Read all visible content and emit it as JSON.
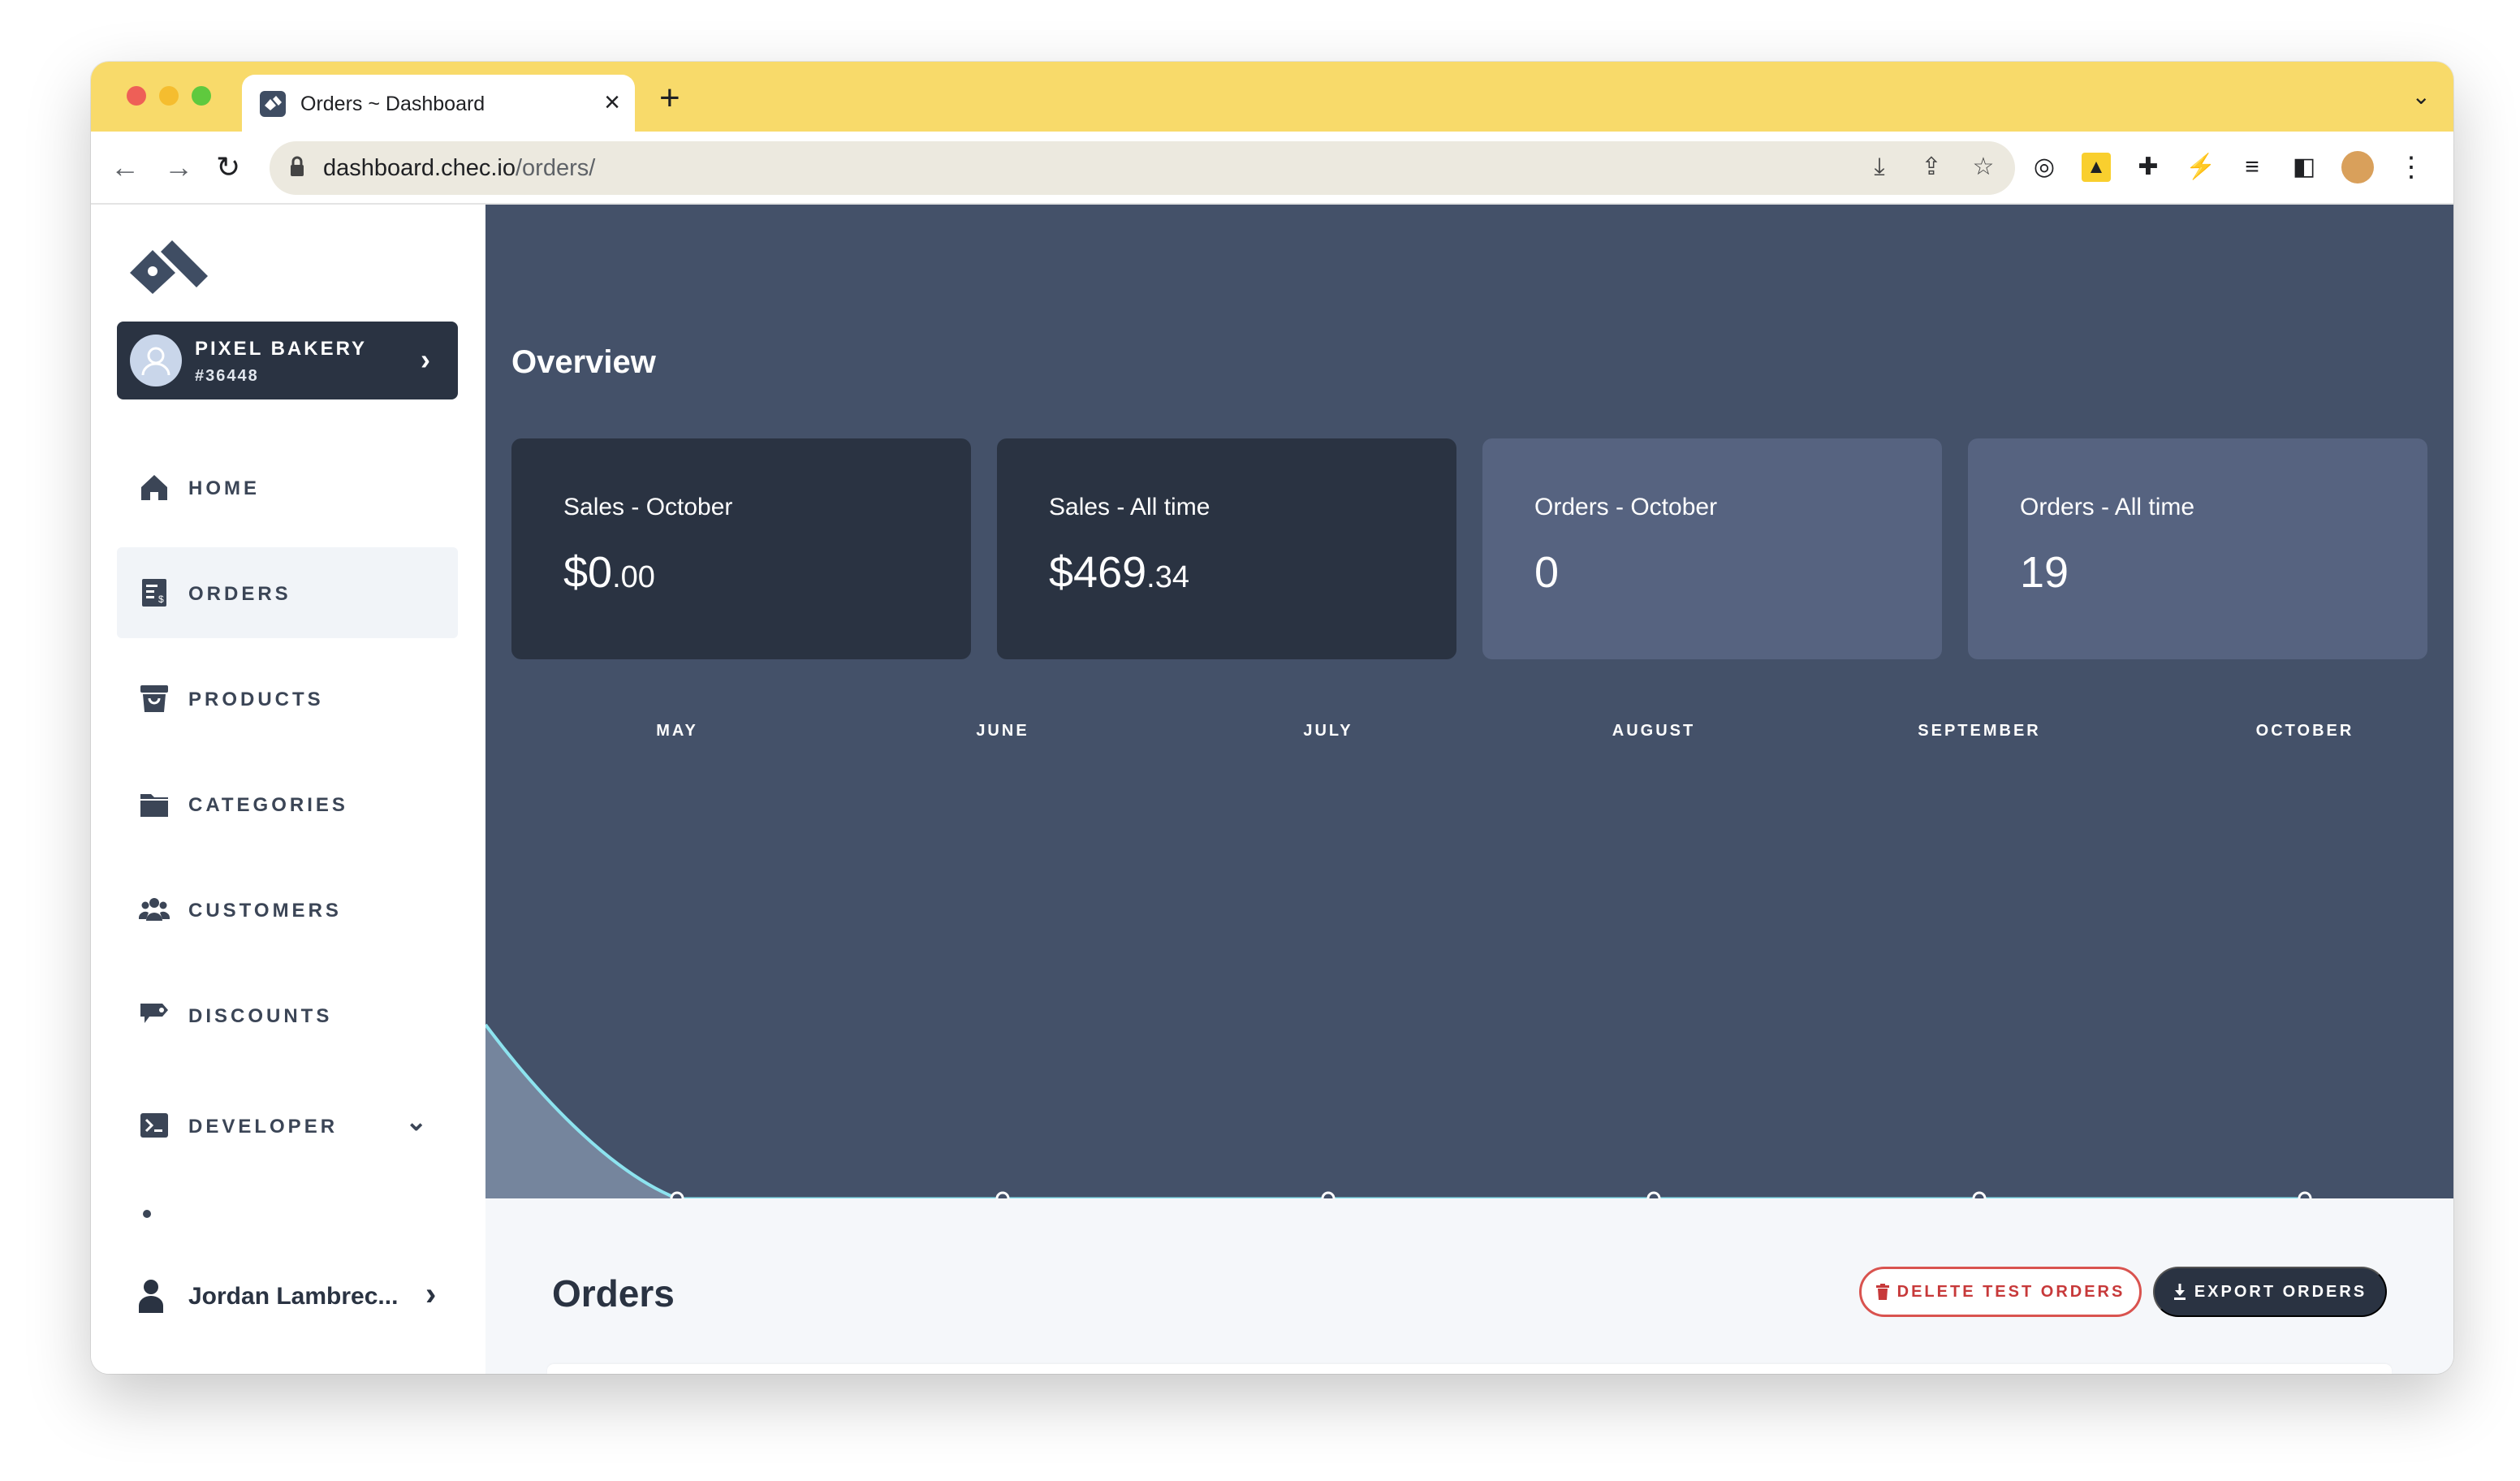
{
  "browser": {
    "tab_title": "Orders ~ Dashboard",
    "tab_close": "×",
    "new_tab": "+",
    "url_host": "dashboard.chec.io",
    "url_path": "/orders/"
  },
  "sidebar": {
    "store": {
      "name": "PIXEL BAKERY",
      "id": "#36448"
    },
    "items": [
      {
        "label": "HOME",
        "icon": "home-icon"
      },
      {
        "label": "ORDERS",
        "icon": "orders-icon",
        "active": true
      },
      {
        "label": "PRODUCTS",
        "icon": "products-icon"
      },
      {
        "label": "CATEGORIES",
        "icon": "folder-icon"
      },
      {
        "label": "CUSTOMERS",
        "icon": "users-icon"
      },
      {
        "label": "DISCOUNTS",
        "icon": "tag-icon"
      },
      {
        "label": "DEVELOPER",
        "icon": "terminal-icon"
      }
    ],
    "user_name": "Jordan Lambrec..."
  },
  "overview": {
    "title": "Overview",
    "cards": [
      {
        "label": "Sales - October",
        "value_main": "$0",
        "value_cents": ".00"
      },
      {
        "label": "Sales - All time",
        "value_main": "$469",
        "value_cents": ".34"
      },
      {
        "label": "Orders - October",
        "value_main": "0",
        "value_cents": ""
      },
      {
        "label": "Orders - All time",
        "value_main": "19",
        "value_cents": ""
      }
    ]
  },
  "chart_data": {
    "type": "area",
    "categories": [
      "MAY",
      "JUNE",
      "JULY",
      "AUGUST",
      "SEPTEMBER",
      "OCTOBER"
    ],
    "series": [
      {
        "values": [
          0,
          0,
          0,
          0,
          0,
          0
        ],
        "color": "#8de3ef"
      }
    ]
  },
  "orders": {
    "title": "Orders",
    "delete_label": "DELETE TEST ORDERS",
    "export_label": "EXPORT ORDERS"
  },
  "colors": {
    "hero": "#445169",
    "card_dark": "#2a3342",
    "card_light": "#566380",
    "titlebar": "#f8da6a",
    "danger": "#d9534f"
  }
}
